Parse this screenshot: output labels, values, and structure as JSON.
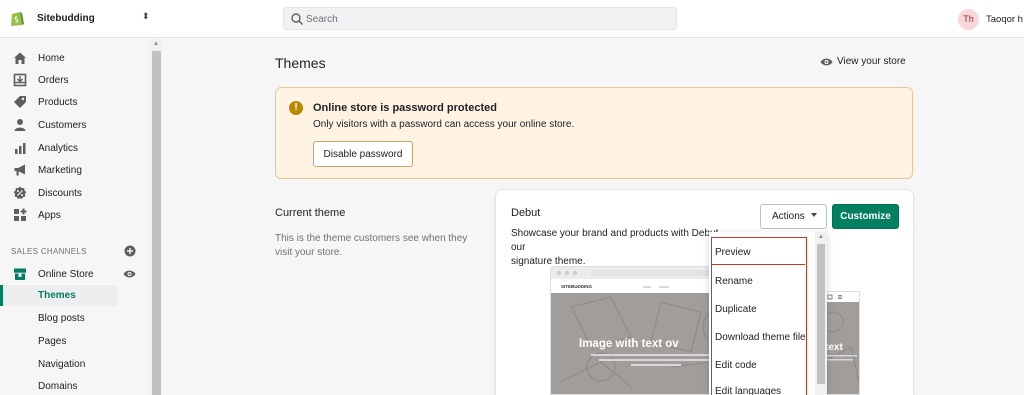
{
  "topbar": {
    "store_name": "Sitebudding",
    "search_placeholder": "Search",
    "avatar_initials": "Th",
    "user_name": "Taoqor h"
  },
  "sidebar": {
    "items": [
      {
        "label": "Home",
        "icon": "home-icon"
      },
      {
        "label": "Orders",
        "icon": "orders-icon"
      },
      {
        "label": "Products",
        "icon": "tag-icon"
      },
      {
        "label": "Customers",
        "icon": "person-icon"
      },
      {
        "label": "Analytics",
        "icon": "bar-chart-icon"
      },
      {
        "label": "Marketing",
        "icon": "megaphone-icon"
      },
      {
        "label": "Discounts",
        "icon": "discount-icon"
      },
      {
        "label": "Apps",
        "icon": "apps-icon"
      }
    ],
    "sales_channels_label": "SALES CHANNELS",
    "online_store_label": "Online Store",
    "sub_items": [
      {
        "label": "Themes",
        "active": true
      },
      {
        "label": "Blog posts",
        "active": false
      },
      {
        "label": "Pages",
        "active": false
      },
      {
        "label": "Navigation",
        "active": false
      },
      {
        "label": "Domains",
        "active": false
      }
    ]
  },
  "main": {
    "title": "Themes",
    "view_store_label": "View your store",
    "banner": {
      "title": "Online store is password protected",
      "text": "Only visitors with a password can access your online store.",
      "button_label": "Disable password"
    },
    "current_theme": {
      "heading": "Current theme",
      "description": "This is the theme customers see when they visit your store."
    },
    "theme_card": {
      "name": "Debut",
      "description_line1": "Showcase your brand and products with Debut, our",
      "description_line2": "signature theme.",
      "actions_label": "Actions",
      "customize_label": "Customize",
      "preview_store_name": "SITEBUDDING",
      "preview_hero_text": "Image with text ov",
      "preview_mobile_text": "text"
    }
  },
  "actions_menu": {
    "items": [
      "Preview",
      "Rename",
      "Duplicate",
      "Download theme file",
      "Edit code",
      "Edit languages"
    ]
  },
  "colors": {
    "accent_green": "#008060",
    "banner_bg": "#fff4e4",
    "highlight_red": "#c0392b"
  }
}
